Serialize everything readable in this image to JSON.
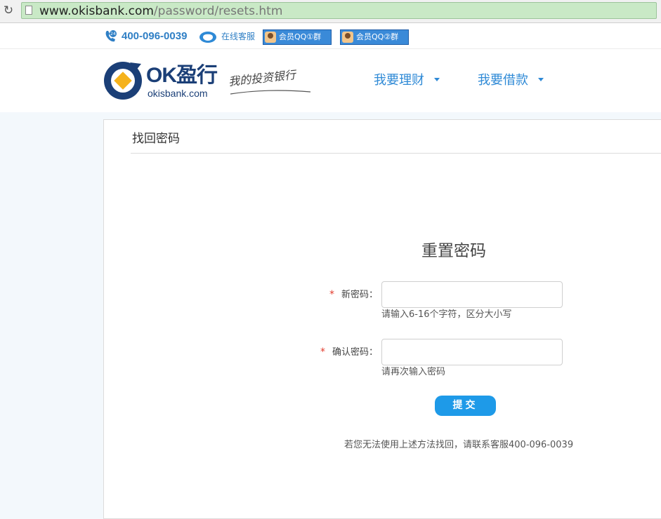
{
  "browser": {
    "url_host": "www.okisbank.com",
    "url_path": "/password/resets.htm",
    "reload_icon": "reload-icon"
  },
  "top_bar": {
    "phone": "400-096-0039",
    "online_service": "在线客服",
    "qq_groups": [
      "会员QQ①群",
      "会员QQ②群"
    ]
  },
  "header": {
    "logo_ok": "OK盈行",
    "logo_domain": "okisbank.com",
    "slogan": "我的投资银行",
    "nav": [
      "我要理财",
      "我要借款"
    ]
  },
  "panel": {
    "title": "找回密码",
    "form_heading": "重置密码",
    "fields": [
      {
        "label": "新密码：",
        "required_mark": "*",
        "value": "",
        "hint": "请输入6-16个字符，区分大小写"
      },
      {
        "label": "确认密码：",
        "required_mark": "*",
        "value": "",
        "hint": "请再次输入密码"
      }
    ],
    "submit_label": "提交",
    "help_text": "若您无法使用上述方法找回，请联系客服400-096-0039"
  },
  "colors": {
    "brand_blue": "#2f8ad6",
    "logo_navy": "#1b3f77",
    "submit_blue": "#1e9ae8",
    "required_red": "#e23b2c",
    "url_bar_green": "#c9e9c6"
  }
}
